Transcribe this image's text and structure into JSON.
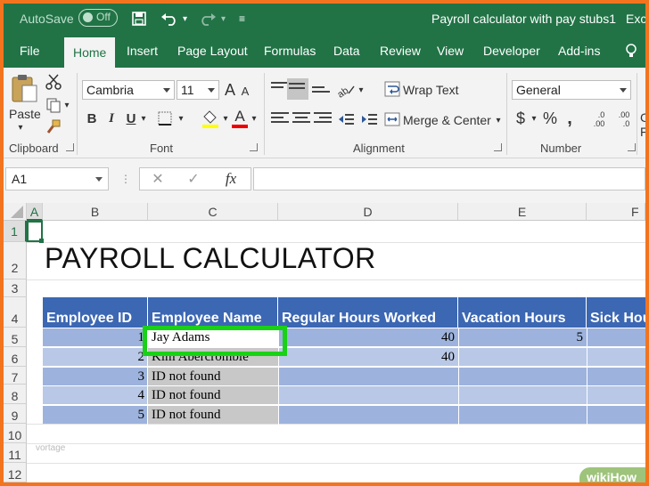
{
  "titlebar": {
    "autosave_label": "AutoSave",
    "autosave_state": "Off",
    "doc_title": "Payroll calculator with pay stubs1",
    "app_name_partial": "Exc"
  },
  "tabs": [
    "File",
    "Home",
    "Insert",
    "Page Layout",
    "Formulas",
    "Data",
    "Review",
    "View",
    "Developer",
    "Add-ins"
  ],
  "ribbon": {
    "clipboard": {
      "paste_label": "Paste",
      "group_label": "Clipboard"
    },
    "font": {
      "font_name": "Cambria",
      "font_size": "11",
      "grow": "A",
      "shrink": "A",
      "bold": "B",
      "italic": "I",
      "underline": "U",
      "font_color_glyph": "A",
      "group_label": "Font"
    },
    "alignment": {
      "wrap_text": "Wrap Text",
      "merge_center": "Merge & Center",
      "group_label": "Alignment"
    },
    "number": {
      "format": "General",
      "currency": "$",
      "percent": "%",
      "comma": ",",
      "inc_decimal": ".0\n.00",
      "dec_decimal": ".00\n.0",
      "group_label": "Number"
    },
    "cut_off_right": [
      "Co",
      "Fo"
    ]
  },
  "formula_bar": {
    "name_box": "A1",
    "cancel": "✕",
    "enter": "✓",
    "fx": "fx",
    "value": ""
  },
  "columns": [
    "A",
    "B",
    "C",
    "D",
    "E",
    "F"
  ],
  "rows": [
    "1",
    "2",
    "3",
    "4",
    "5",
    "6",
    "7",
    "8",
    "9",
    "10",
    "11",
    "12"
  ],
  "sheet": {
    "title": "PAYROLL CALCULATOR",
    "headers": [
      "Employee ID",
      "Employee Name",
      "Regular Hours Worked",
      "Vacation Hours",
      "Sick Hou"
    ],
    "data_rows": [
      {
        "id": "1",
        "name": "Jay Adams",
        "regular": "40",
        "vacation": "5"
      },
      {
        "id": "2",
        "name": "Kim Abercrombie",
        "regular": "40",
        "vacation": ""
      },
      {
        "id": "3",
        "name": "ID not found",
        "regular": "",
        "vacation": ""
      },
      {
        "id": "4",
        "name": "ID not found",
        "regular": "",
        "vacation": ""
      },
      {
        "id": "5",
        "name": "ID not found",
        "regular": "",
        "vacation": ""
      }
    ],
    "watermark": "vortage",
    "brand": "wikiHow"
  },
  "colors": {
    "excel_green": "#217346",
    "table_header": "#3c67b3",
    "row_band_light": "#b8c8e6",
    "row_band_dark": "#9db3dd",
    "name_col_gray": "#c8c8c8",
    "highlight": "#19d116",
    "frame": "#f2741f"
  }
}
